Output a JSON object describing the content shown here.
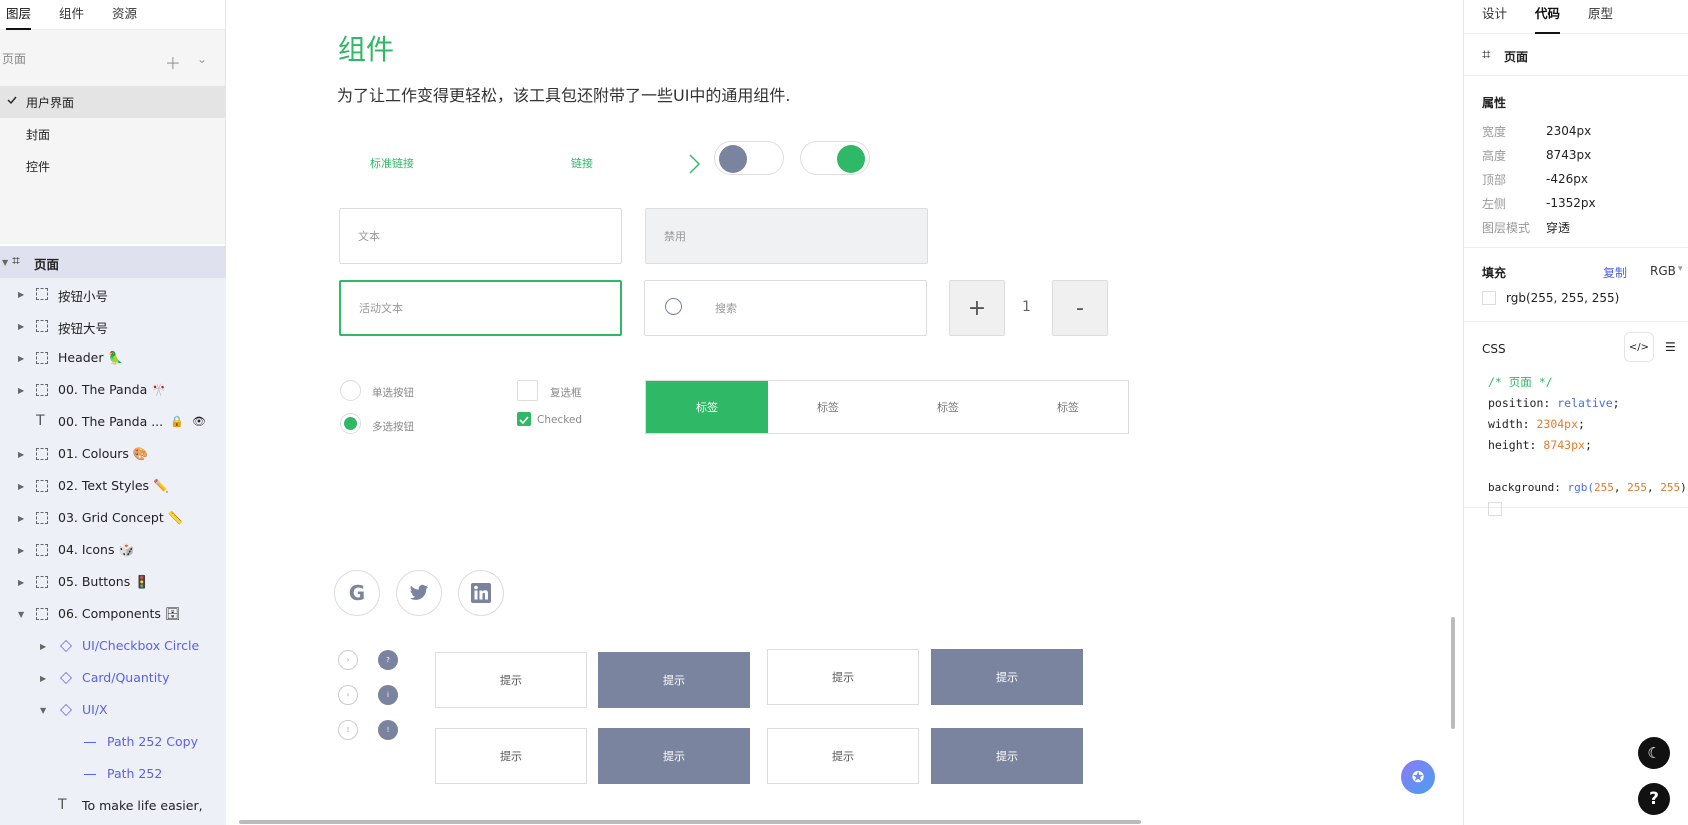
{
  "left": {
    "tabs": [
      "图层",
      "组件",
      "资源"
    ],
    "pages_label": "页面",
    "pages": [
      "用户界面",
      "封面",
      "控件"
    ],
    "layers_root": "页面",
    "layers": [
      {
        "name": "按钮小号",
        "kind": "frame",
        "emoji": ""
      },
      {
        "name": "按钮大号",
        "kind": "frame",
        "emoji": ""
      },
      {
        "name": "Header",
        "kind": "frame",
        "emoji": "🦜"
      },
      {
        "name": "00. The Panda",
        "kind": "frame",
        "emoji": "🎌"
      },
      {
        "name": "00. The Panda ...",
        "kind": "text",
        "emoji": ""
      },
      {
        "name": "01. Colours",
        "kind": "frame",
        "emoji": "🎨"
      },
      {
        "name": "02. Text Styles",
        "kind": "frame",
        "emoji": "✏️"
      },
      {
        "name": "03. Grid Concept",
        "kind": "frame",
        "emoji": "📏"
      },
      {
        "name": "04. Icons",
        "kind": "frame",
        "emoji": "🎲"
      },
      {
        "name": "05. Buttons",
        "kind": "frame",
        "emoji": "🚦"
      },
      {
        "name": "06. Components",
        "kind": "frame",
        "emoji": "🗄"
      },
      {
        "name": "UI/Checkbox Circle",
        "kind": "component",
        "emoji": ""
      },
      {
        "name": "Card/Quantity",
        "kind": "component",
        "emoji": ""
      },
      {
        "name": "UI/X",
        "kind": "component",
        "emoji": ""
      },
      {
        "name": "Path 252 Copy",
        "kind": "path",
        "emoji": ""
      },
      {
        "name": "Path 252",
        "kind": "path",
        "emoji": ""
      },
      {
        "name": "To make life easier,",
        "kind": "text",
        "emoji": ""
      }
    ]
  },
  "canvas": {
    "title": "组件",
    "subtitle": "为了让工作变得更轻松，该工具包还附带了一些UI中的通用组件.",
    "link_standard": "标准链接",
    "link": "链接",
    "input_text": "文本",
    "input_disabled": "禁用",
    "input_active": "活动文本",
    "input_search": "搜索",
    "stepper_plus": "+",
    "stepper_value": "1",
    "stepper_minus": "-",
    "radio_label": "单选按钮",
    "radio_multi_label": "多选按钮",
    "checkbox_label": "复选框",
    "checked_label": "Checked",
    "tabs": [
      "标签",
      "标签",
      "标签",
      "标签"
    ],
    "tooltip": "提示",
    "mini_icons_outline": [
      "›",
      "‹",
      "!"
    ],
    "mini_icons_filled": [
      "?",
      "i",
      "!"
    ]
  },
  "right": {
    "tabs": [
      "设计",
      "代码",
      "原型"
    ],
    "frame_label": "页面",
    "props_title": "属性",
    "props": [
      {
        "k": "宽度",
        "v": "2304px"
      },
      {
        "k": "高度",
        "v": "8743px"
      },
      {
        "k": "顶部",
        "v": "-426px"
      },
      {
        "k": "左侧",
        "v": "-1352px"
      },
      {
        "k": "图层模式",
        "v": "穿透"
      }
    ],
    "fill_title": "填充",
    "copy_label": "复制",
    "color_mode": "RGB",
    "fill_value": "rgb(255, 255, 255)",
    "css_title": "CSS",
    "code": {
      "comment": "/* 页面 */",
      "position_k": "position:",
      "position_v": "relative",
      "width_k": "width:",
      "width_v": "2304px",
      "height_k": "height:",
      "height_v": "8743px",
      "bg_k": "background:",
      "bg_fn": "rgb(",
      "bg_r": "255",
      "bg_g": "255",
      "bg_b": "255",
      "bg_end": ");"
    }
  },
  "colors": {
    "accent": "#2fb866",
    "gray_blue": "#7a849e",
    "component": "#5b5fe6"
  }
}
